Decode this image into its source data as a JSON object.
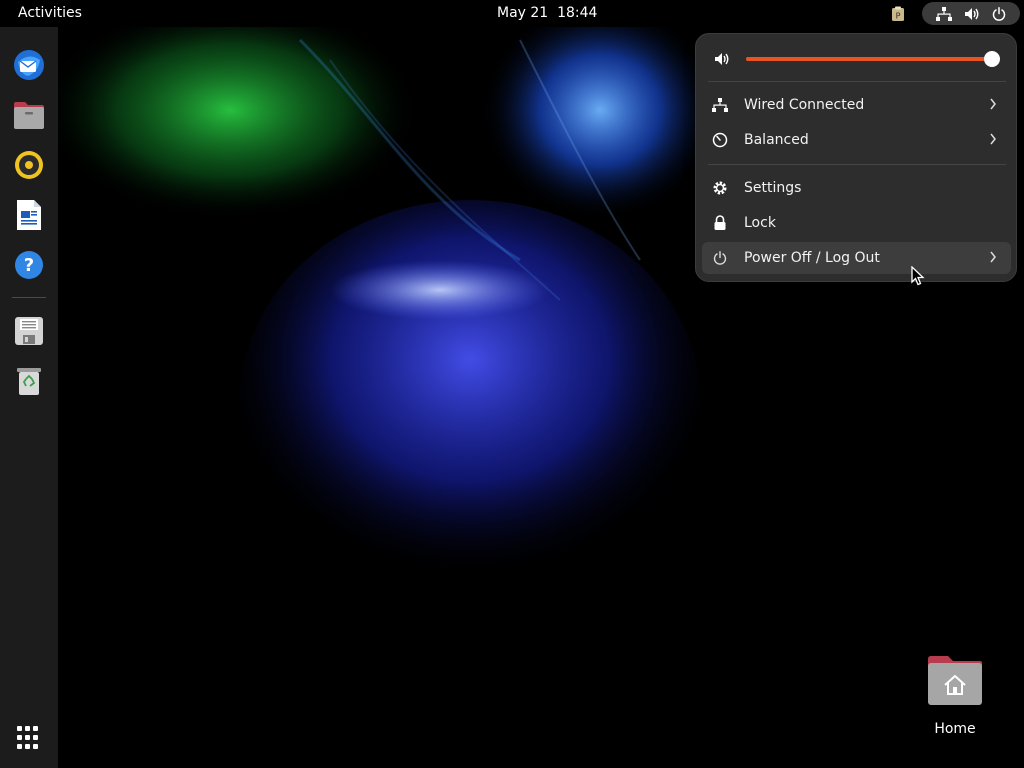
{
  "topbar": {
    "activities_label": "Activities",
    "clock": "May 21  18:44",
    "tray_icons": [
      "clipboard-icon",
      "network-wired-icon",
      "volume-icon",
      "power-icon"
    ]
  },
  "dock": {
    "apps": [
      {
        "name": "Thunderbird Mail",
        "icon": "thunderbird-icon"
      },
      {
        "name": "Files",
        "icon": "files-icon"
      },
      {
        "name": "Rhythmbox",
        "icon": "rhythmbox-icon"
      },
      {
        "name": "LibreOffice Writer",
        "icon": "writer-icon"
      },
      {
        "name": "Help",
        "icon": "help-icon"
      },
      {
        "name": "Save",
        "icon": "floppy-icon"
      },
      {
        "name": "Trash",
        "icon": "trash-icon"
      }
    ],
    "show_apps_icon": "apps-grid-icon"
  },
  "quick_settings": {
    "volume_percent": 100,
    "items": [
      {
        "label": "Wired Connected",
        "icon": "network-wired-icon",
        "has_submenu": true
      },
      {
        "label": "Balanced",
        "icon": "power-profile-icon",
        "has_submenu": true
      },
      {
        "label": "Settings",
        "icon": "gear-icon",
        "has_submenu": false
      },
      {
        "label": "Lock",
        "icon": "lock-icon",
        "has_submenu": false
      },
      {
        "label": "Power Off / Log Out",
        "icon": "power-icon",
        "has_submenu": true
      }
    ]
  },
  "desktop": {
    "icons": [
      {
        "label": "Home",
        "icon": "home-folder-icon"
      }
    ]
  },
  "colors": {
    "accent": "#e95420",
    "panel_bg": "#000000",
    "dock_bg": "#1c1c1c",
    "menu_bg": "#2d2d2d"
  }
}
